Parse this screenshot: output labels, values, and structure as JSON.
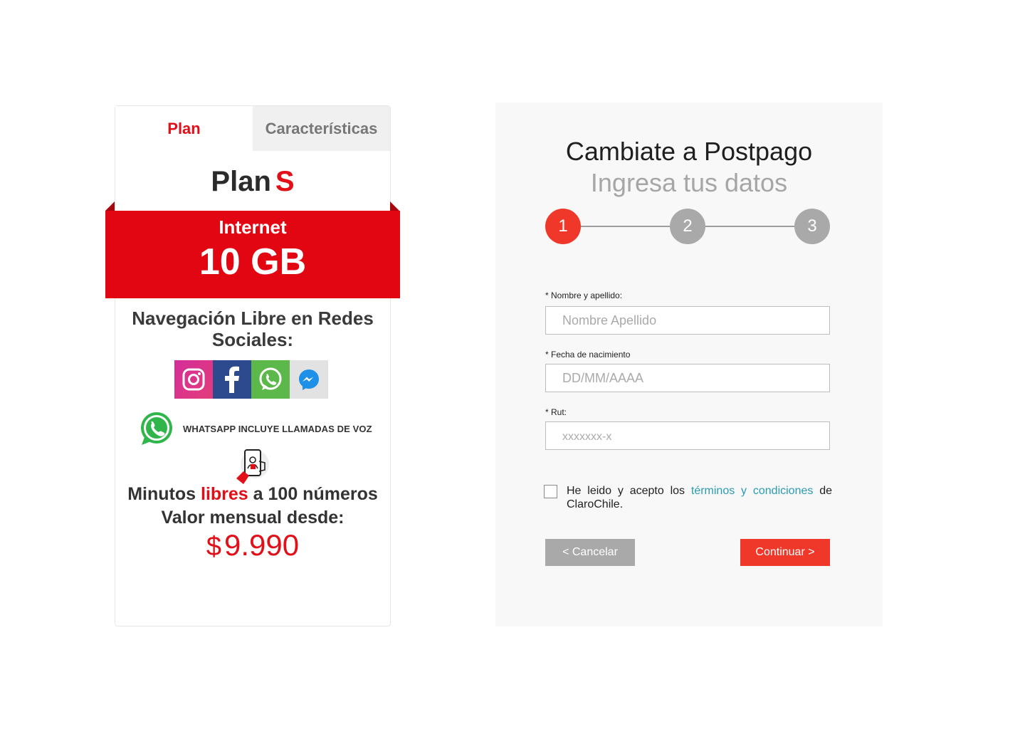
{
  "plan_card": {
    "tabs": [
      {
        "label": "Plan",
        "active": true
      },
      {
        "label": "Características",
        "active": false
      }
    ],
    "plan_prefix": "Plan",
    "plan_size": "S",
    "internet_label": "Internet",
    "internet_amount": "10 GB",
    "social_title": "Navegación Libre en Redes Sociales:",
    "social_icons": [
      "instagram-icon",
      "facebook-icon",
      "whatsapp-icon",
      "messenger-icon"
    ],
    "whatsapp_note": "WHATSAPP INCLUYE LLAMADAS DE VOZ",
    "minutes_pre": "Minutos",
    "minutes_highlight": "libres",
    "minutes_post": "a 100 números",
    "monthly_label": "Valor mensual desde:",
    "price_currency": "$",
    "price_value": "9.990"
  },
  "form": {
    "title": "Cambiate a Postpago",
    "subtitle": "Ingresa tus datos",
    "steps": [
      "1",
      "2",
      "3"
    ],
    "current_step": 1,
    "fields": {
      "name": {
        "label": "* Nombre y apellido:",
        "placeholder": "Nombre Apellido",
        "value": ""
      },
      "birthdate": {
        "label": "* Fecha de nacimiento",
        "placeholder": "DD/MM/AAAA",
        "value": ""
      },
      "rut": {
        "label": "* Rut:",
        "placeholder": "xxxxxxx-x",
        "value": ""
      }
    },
    "terms": {
      "checked": false,
      "text_before": "He leido y acepto los ",
      "link_text": "términos y condiciones",
      "text_after": " de ClaroChile."
    },
    "cancel_label": "< Cancelar",
    "continue_label": "Continuar >"
  },
  "colors": {
    "brand_red": "#e20613",
    "step_active": "#ef3829",
    "step_inactive": "#a9a9a9",
    "link": "#2a9bb5"
  }
}
